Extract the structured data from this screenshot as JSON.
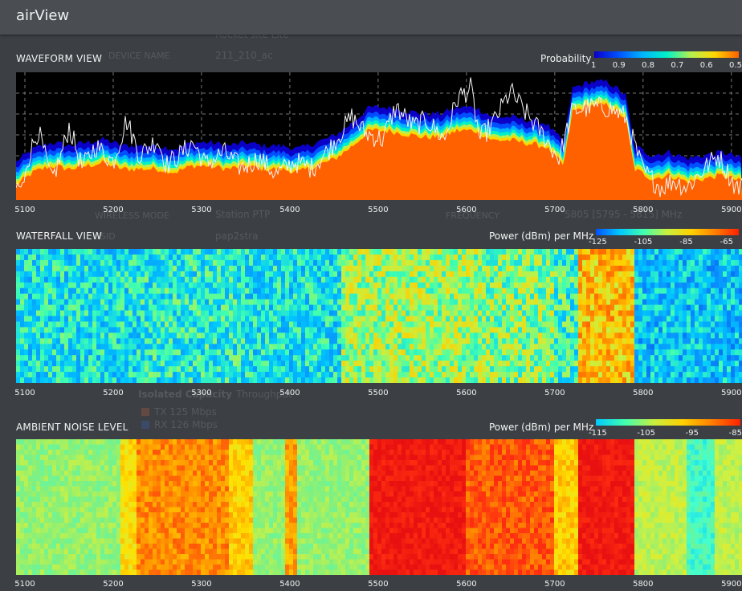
{
  "app": {
    "title": "airView"
  },
  "background_ghost": {
    "device_name_label": "DEVICE NAME",
    "device_name_value": "211_210_ac",
    "location_value": "Rocket site Lite",
    "wireless_mode_label": "WIRELESS MODE",
    "wireless_mode_value": "Station PTP",
    "ssid_label": "SSID",
    "ssid_value": "pap2stra",
    "frequency_label": "FREQUENCY",
    "frequency_value": "5805 [5795 - 5815] MHz",
    "tab_isolated": "Isolated Capacity",
    "tab_throughput": "Throughput",
    "tx_capacity": "TX 125 Mbps",
    "rx_capacity": "RX 126 Mbps"
  },
  "sections": {
    "waveform": {
      "title": "WAVEFORM VIEW",
      "scale_title": "Probability",
      "scale_ticks": [
        "1",
        "0.9",
        "0.8",
        "0.7",
        "0.6",
        "0.5"
      ]
    },
    "waterfall": {
      "title": "WATERFALL VIEW",
      "scale_title": "Power (dBm) per MHz",
      "scale_ticks": [
        "-125",
        "-105",
        "-85",
        "-65"
      ]
    },
    "ambient": {
      "title": "AMBIENT NOISE LEVEL",
      "scale_title": "Power (dBm) per MHz",
      "scale_ticks": [
        "-115",
        "-105",
        "-95",
        "-85"
      ]
    }
  },
  "frequency_axis": {
    "unit": "MHz",
    "min": 5090,
    "max": 5912,
    "ticks": [
      "5100",
      "5200",
      "5300",
      "5400",
      "5500",
      "5600",
      "5700",
      "5800",
      "5900"
    ]
  },
  "colors": {
    "background": "#3c4044",
    "plot_background": "#000000",
    "probability_scale": [
      "#0a00c8",
      "#0050ff",
      "#00b4ff",
      "#00f0c8",
      "#b4f050",
      "#ffd700",
      "#ff6000"
    ],
    "power_scale": [
      "#0050ff",
      "#00c8ff",
      "#40ffb0",
      "#c8f040",
      "#ffd000",
      "#ff8000",
      "#ff2000"
    ]
  },
  "chart_data": [
    {
      "type": "area",
      "title": "WAVEFORM VIEW",
      "xlabel": "",
      "ylabel": "",
      "x_range_mhz": [
        5090,
        5912
      ],
      "legend_title": "Probability",
      "legend_ticks": [
        1,
        0.9,
        0.8,
        0.7,
        0.6,
        0.5
      ],
      "grid": true,
      "envelope_points": [
        [
          5090,
          -109
        ],
        [
          5110,
          -105
        ],
        [
          5130,
          -103
        ],
        [
          5150,
          -104
        ],
        [
          5170,
          -103
        ],
        [
          5190,
          -102
        ],
        [
          5210,
          -104
        ],
        [
          5230,
          -104
        ],
        [
          5250,
          -104
        ],
        [
          5270,
          -105
        ],
        [
          5290,
          -103
        ],
        [
          5310,
          -103
        ],
        [
          5330,
          -104
        ],
        [
          5350,
          -103
        ],
        [
          5370,
          -104
        ],
        [
          5390,
          -104
        ],
        [
          5410,
          -105
        ],
        [
          5430,
          -103
        ],
        [
          5450,
          -101
        ],
        [
          5470,
          -97
        ],
        [
          5490,
          -92
        ],
        [
          5510,
          -92
        ],
        [
          5530,
          -93
        ],
        [
          5550,
          -94
        ],
        [
          5570,
          -94
        ],
        [
          5590,
          -92
        ],
        [
          5610,
          -92
        ],
        [
          5630,
          -95
        ],
        [
          5650,
          -95
        ],
        [
          5670,
          -96
        ],
        [
          5690,
          -97
        ],
        [
          5710,
          -103
        ],
        [
          5720,
          -86
        ],
        [
          5740,
          -84
        ],
        [
          5760,
          -84
        ],
        [
          5780,
          -88
        ],
        [
          5790,
          -104
        ],
        [
          5810,
          -107
        ],
        [
          5830,
          -106
        ],
        [
          5850,
          -108
        ],
        [
          5870,
          -107
        ],
        [
          5890,
          -106
        ],
        [
          5912,
          -108
        ]
      ],
      "peak_points": [
        [
          5100,
          -104
        ],
        [
          5115,
          -92
        ],
        [
          5130,
          -108
        ],
        [
          5140,
          -101
        ],
        [
          5150,
          -91
        ],
        [
          5165,
          -104
        ],
        [
          5180,
          -97
        ],
        [
          5200,
          -102
        ],
        [
          5215,
          -89
        ],
        [
          5230,
          -100
        ],
        [
          5250,
          -95
        ],
        [
          5260,
          -103
        ],
        [
          5275,
          -100
        ],
        [
          5290,
          -96
        ],
        [
          5305,
          -103
        ],
        [
          5325,
          -99
        ],
        [
          5345,
          -104
        ],
        [
          5365,
          -101
        ],
        [
          5385,
          -106
        ],
        [
          5405,
          -102
        ],
        [
          5425,
          -104
        ],
        [
          5445,
          -98
        ],
        [
          5470,
          -88
        ],
        [
          5485,
          -93
        ],
        [
          5505,
          -95
        ],
        [
          5520,
          -85
        ],
        [
          5540,
          -91
        ],
        [
          5555,
          -89
        ],
        [
          5575,
          -95
        ],
        [
          5590,
          -82
        ],
        [
          5605,
          -79
        ],
        [
          5615,
          -95
        ],
        [
          5630,
          -90
        ],
        [
          5650,
          -80
        ],
        [
          5665,
          -86
        ],
        [
          5685,
          -93
        ],
        [
          5705,
          -101
        ],
        [
          5720,
          -86
        ],
        [
          5740,
          -85
        ],
        [
          5760,
          -85
        ],
        [
          5780,
          -88
        ],
        [
          5800,
          -105
        ],
        [
          5820,
          -110
        ],
        [
          5835,
          -108
        ],
        [
          5850,
          -110
        ],
        [
          5870,
          -104
        ],
        [
          5885,
          -100
        ],
        [
          5905,
          -110
        ]
      ]
    },
    {
      "type": "heatmap",
      "title": "WATERFALL VIEW",
      "x_range_mhz": [
        5090,
        5912
      ],
      "legend_title": "Power (dBm) per MHz",
      "legend_range_dbm": [
        -125,
        -65
      ],
      "band_levels_dbm": [
        [
          5090,
          5230,
          -100
        ],
        [
          5230,
          5350,
          -99
        ],
        [
          5350,
          5460,
          -100
        ],
        [
          5460,
          5530,
          -94
        ],
        [
          5530,
          5620,
          -94
        ],
        [
          5620,
          5700,
          -95
        ],
        [
          5700,
          5725,
          -98
        ],
        [
          5725,
          5790,
          -88
        ],
        [
          5790,
          5912,
          -102
        ]
      ]
    },
    {
      "type": "heatmap",
      "title": "AMBIENT NOISE LEVEL",
      "x_range_mhz": [
        5090,
        5912
      ],
      "legend_title": "Power (dBm) per MHz",
      "legend_range_dbm": [
        -115,
        -85
      ],
      "band_levels_dbm": [
        [
          5090,
          5210,
          -102
        ],
        [
          5210,
          5225,
          -96
        ],
        [
          5225,
          5330,
          -92
        ],
        [
          5330,
          5360,
          -95
        ],
        [
          5360,
          5395,
          -102
        ],
        [
          5395,
          5410,
          -93
        ],
        [
          5410,
          5490,
          -102
        ],
        [
          5490,
          5600,
          -86
        ],
        [
          5600,
          5700,
          -90
        ],
        [
          5700,
          5725,
          -95
        ],
        [
          5725,
          5790,
          -86
        ],
        [
          5790,
          5850,
          -100
        ],
        [
          5850,
          5880,
          -106
        ],
        [
          5880,
          5912,
          -100
        ]
      ]
    }
  ]
}
